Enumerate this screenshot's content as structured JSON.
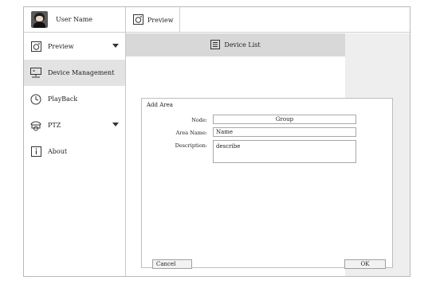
{
  "user": {
    "name": "User Name"
  },
  "tabs": [
    {
      "label": "Preview"
    }
  ],
  "sidebar": {
    "items": [
      {
        "label": "Preview"
      },
      {
        "label": "Device Management"
      },
      {
        "label": "PlayBack"
      },
      {
        "label": "PTZ"
      },
      {
        "label": "About"
      }
    ]
  },
  "device_list": {
    "label": "Device List"
  },
  "dialog": {
    "title": "Add Area",
    "node_label": "Node:",
    "node_value": "Group",
    "area_name_label": "Area Name:",
    "area_name_value": "Name",
    "description_label": "Description:",
    "description_value": "describe",
    "cancel_label": "Cancel",
    "ok_label": "OK"
  }
}
